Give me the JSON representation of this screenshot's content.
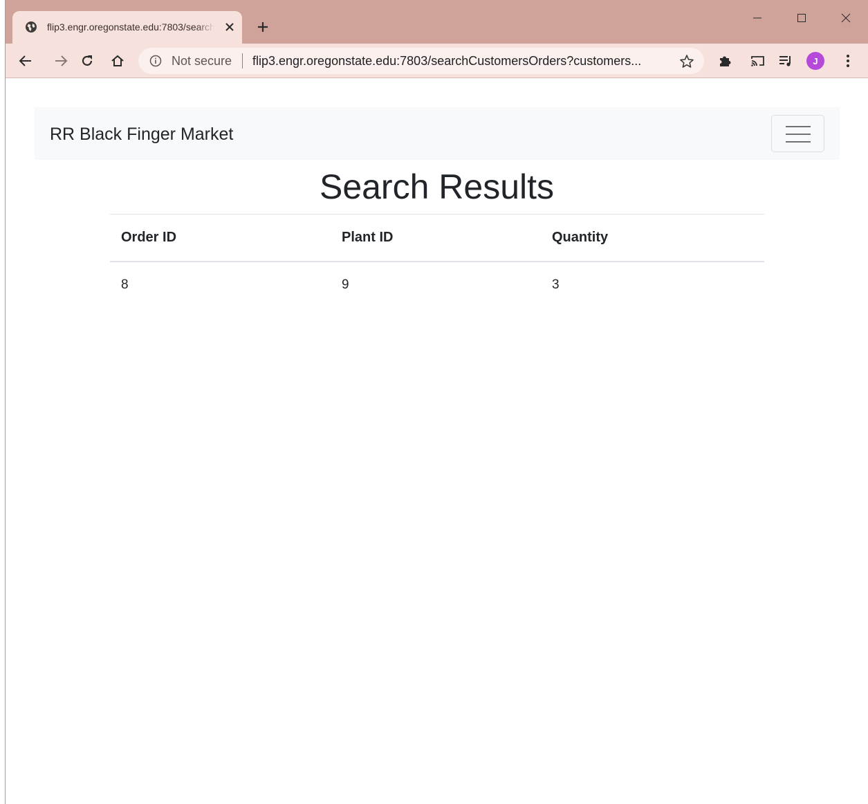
{
  "browser": {
    "tab": {
      "title": "flip3.engr.oregonstate.edu:7803/searchCustomersOrders"
    },
    "omnibox": {
      "security_label": "Not secure",
      "url": "flip3.engr.oregonstate.edu:7803/searchCustomersOrders?customers..."
    },
    "profile_initial": "J",
    "colors": {
      "frame": "#cfa399",
      "toolbar": "#f6e1dc",
      "avatar": "#b549d9"
    }
  },
  "navbar": {
    "brand": "RR Black Finger Market"
  },
  "main": {
    "heading": "Search Results",
    "table": {
      "headers": [
        "Order ID",
        "Plant ID",
        "Quantity"
      ],
      "rows": [
        [
          "8",
          "9",
          "3"
        ]
      ]
    }
  }
}
